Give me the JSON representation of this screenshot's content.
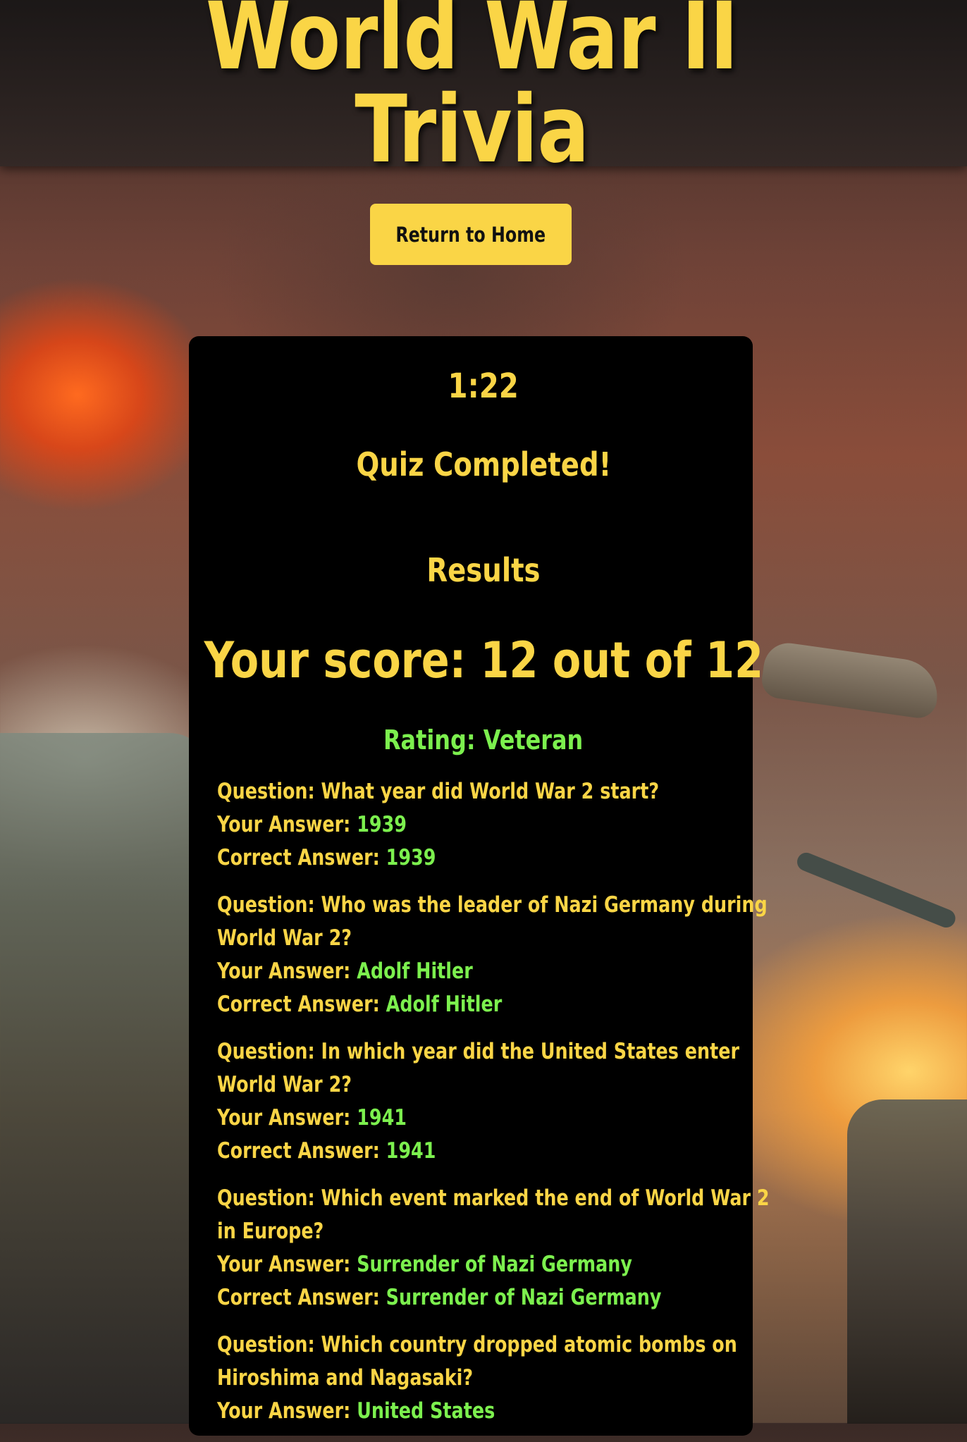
{
  "header": {
    "title": "World War II Trivia"
  },
  "nav": {
    "home_button": "Return to Home"
  },
  "quiz": {
    "timer": "1:22",
    "status": "Quiz Completed!",
    "results_heading": "Results",
    "score_text": "Your score: 12 out of 12",
    "rating_label": "Rating:",
    "rating_value": "Veteran"
  },
  "labels": {
    "question": "Question:",
    "your_answer": "Your Answer:",
    "correct_answer": "Correct Answer:"
  },
  "results": [
    {
      "q1": "What year did World War 2 start?",
      "q2": "",
      "your": "1939",
      "correct": "1939"
    },
    {
      "q1": "Who was the leader of Nazi Germany during",
      "q2": "World War 2?",
      "your": "Adolf Hitler",
      "correct": "Adolf Hitler"
    },
    {
      "q1": "In which year did the United States enter",
      "q2": "World War 2?",
      "your": "1941",
      "correct": "1941"
    },
    {
      "q1": "Which event marked the end of World War 2",
      "q2": "in Europe?",
      "your": "Surrender of Nazi Germany",
      "correct": "Surrender of Nazi Germany"
    },
    {
      "q1": "Which country dropped atomic bombs on",
      "q2": "Hiroshima and Nagasaki?",
      "your": "United States",
      "correct": ""
    }
  ],
  "colors": {
    "accent": "#fad546",
    "correct": "#7cf04e",
    "card": "#000000"
  }
}
